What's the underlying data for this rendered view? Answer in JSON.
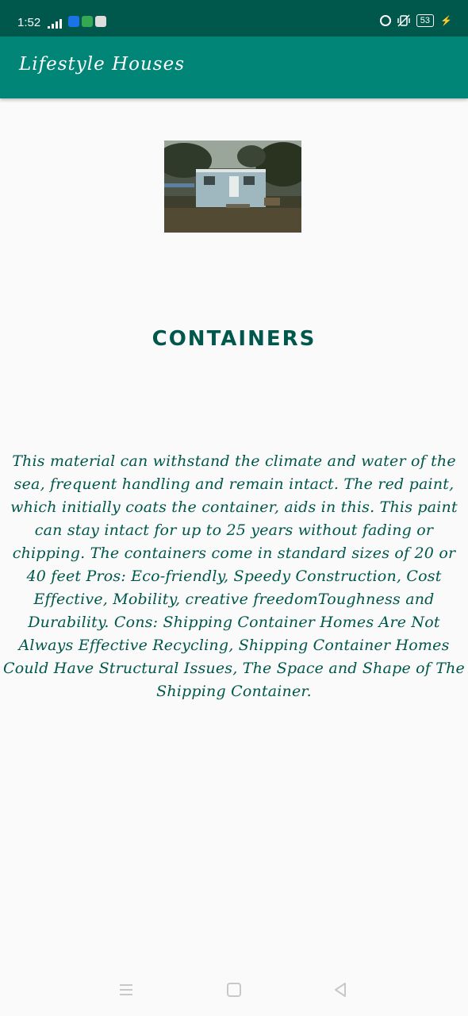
{
  "status_bar": {
    "time": "1:52",
    "battery": "53",
    "icons": [
      "signal-icon",
      "notification-icons",
      "sync-icon",
      "vibrate-icon",
      "battery-icon",
      "charging-icon"
    ]
  },
  "app_bar": {
    "title": "Lifestyle Houses"
  },
  "content": {
    "image": "container-house-photo",
    "heading": "CONTAINERS",
    "body": "This material can withstand the climate and water of the sea, frequent handling and remain intact. The red paint, which initially coats the container, aids in this. This paint can stay intact for up to 25 years without fading or chipping. The containers come in standard sizes of 20 or 40 feet   Pros: Eco-friendly,  Speedy Construction, Cost Effective, Mobility, creative freedomToughness and Durability.   Cons: Shipping Container Homes Are Not Always Effective Recycling, Shipping Container Homes Could Have Structural Issues, The Space and Shape of The Shipping Container."
  },
  "nav_bar": {
    "buttons": [
      "menu",
      "home",
      "back"
    ]
  },
  "colors": {
    "status_bar": "#00574b",
    "app_bar": "#008577",
    "text": "#00574b",
    "background": "#fafafa"
  }
}
